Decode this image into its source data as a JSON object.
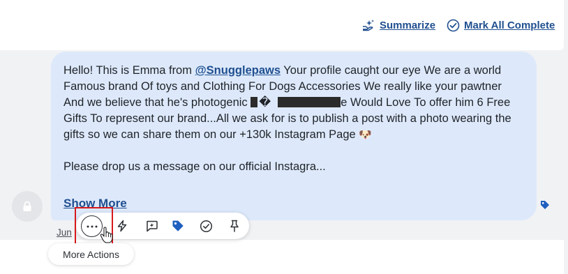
{
  "header": {
    "summarize_label": "Summarize",
    "mark_all_complete_label": "Mark All Complete"
  },
  "message": {
    "greeting": "Hello! This is Emma from ",
    "mention": "@Snugglepaws",
    "line_after_mention": " Your profile caught our eye We are a world Famous brand Of toys and Clothing For Dogs Accessories We really like your pawtner And we believe that he's photogenic ",
    "redacted_glyph": "�",
    "after_redacted": "e Would Love To offer him 6 Free Gifts To represent our brand...All we ask for is to publish a post with a photo wearing the gifts so we can share them on our +130k Instagram Page ",
    "emoji": "🐶",
    "paragraph_2": "Please drop us a message on our official Instagra...",
    "show_more_label": "Show More"
  },
  "date_label": "Jun",
  "toolbar": {
    "icons": [
      "more-actions-icon",
      "lightning-icon",
      "ai-reply-icon",
      "tag-icon",
      "check-circle-icon",
      "pin-icon"
    ]
  },
  "tooltip": {
    "label": "More Actions"
  },
  "colors": {
    "link": "#1f4f8f",
    "bubble": "#dde9fb",
    "tag": "#1f5fbf",
    "highlight": "#d7191c"
  }
}
